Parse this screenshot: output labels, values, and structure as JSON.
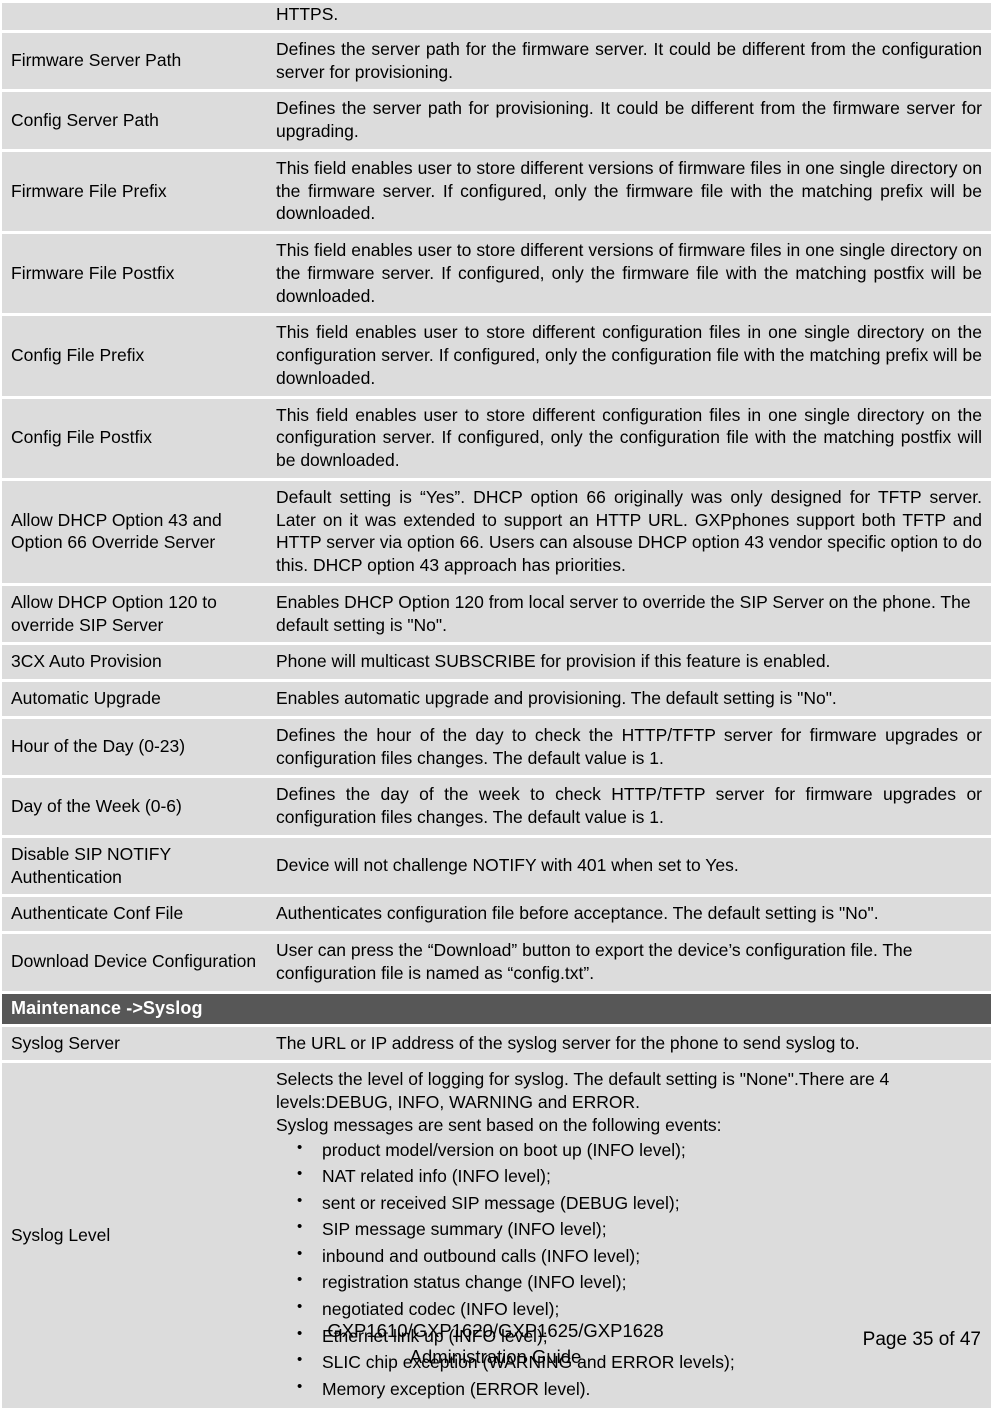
{
  "document": {
    "title": "GXP1610/GXP1620/GXP1625/GXP1628 Administration Guide",
    "footer": {
      "product_line": "GXP1610/GXP1620/GXP1625/GXP1628",
      "guide_line": "Administration Guide",
      "page_label": "Page 35 of 47"
    }
  },
  "table": {
    "clipped_top_row": {
      "name": "",
      "description": "HTTPS."
    },
    "rows": [
      {
        "name": "Firmware Server Path",
        "description": "Defines the server path for the firmware server. It could be different from the configuration server for provisioning."
      },
      {
        "name": "Config Server Path",
        "description": "Defines the server path for provisioning. It could be different from the firmware server for upgrading."
      },
      {
        "name": "Firmware File Prefix",
        "description": "This field enables user to store different versions of firmware files in one single directory on the firmware server. If configured, only the firmware file with the matching prefix will be downloaded."
      },
      {
        "name": "Firmware File Postfix",
        "description": "This field enables user to store different versions of firmware files in one single directory on the firmware server. If configured, only the firmware file with the matching postfix will be downloaded."
      },
      {
        "name": "Config File Prefix",
        "description": "This field enables user to store different configuration files in one single directory on the configuration server. If configured, only the configuration file with the matching prefix will be downloaded."
      },
      {
        "name": "Config File Postfix",
        "description": "This field enables user to store different configuration files in one single directory on the configuration server. If configured, only the configuration file with the matching postfix will be downloaded."
      },
      {
        "name": "Allow DHCP Option 43 and Option 66 Override Server",
        "description": "Default setting is “Yes”. DHCP option 66 originally was only designed for TFTP server. Later on it was extended to support an HTTP URL. GXPphones support both TFTP and HTTP server via option 66. Users can alsouse DHCP option 43 vendor specific option to do this. DHCP option 43 approach has priorities."
      },
      {
        "name": "Allow DHCP Option 120 to override SIP Server",
        "description": "Enables DHCP Option 120 from local server to override the SIP Server on the phone. The default setting is \"No\"."
      },
      {
        "name": "3CX Auto Provision",
        "description": "Phone will multicast SUBSCRIBE for provision if this feature is enabled."
      },
      {
        "name": "Automatic Upgrade",
        "description": "Enables automatic upgrade and provisioning. The default setting is \"No\"."
      },
      {
        "name": "Hour of the Day (0-23)",
        "description": "Defines the hour of the day to check the HTTP/TFTP server for firmware upgrades or configuration files changes. The default value is 1."
      },
      {
        "name": "Day of the Week (0-6)",
        "description": "Defines the day of the week to check HTTP/TFTP server for firmware upgrades or configuration files changes. The default value is 1."
      },
      {
        "name": "Disable SIP NOTIFY Authentication",
        "description": "Device will not challenge NOTIFY with 401 when set to Yes."
      },
      {
        "name": "Authenticate Conf File",
        "description": "Authenticates configuration file before acceptance. The default setting is \"No\"."
      },
      {
        "name": "Download Device Configuration",
        "description": "User can press the “Download” button to export the device’s configuration file. The configuration file is named as “config.txt”."
      }
    ],
    "section_header": "Maintenance ->Syslog",
    "rows_after_section": [
      {
        "name": "Syslog Server",
        "description": "The URL or IP address of the syslog server for the phone to send syslog to."
      }
    ],
    "syslog_level_row": {
      "name": "Syslog Level",
      "intro_line_1": "Selects the level of logging for syslog. The default setting is \"None\".There are 4 levels:DEBUG, INFO, WARNING and ERROR.",
      "intro_line_2": "Syslog messages are sent based on the following events:",
      "bullet_glyph": "•",
      "events": [
        "product model/version on boot up (INFO level);",
        "NAT related info (INFO level);",
        "sent or received SIP message (DEBUG level);",
        "SIP message summary (INFO level);",
        "inbound and outbound calls (INFO level);",
        "registration status change (INFO level);",
        "negotiated codec (INFO level);",
        "Ethernet link up (INFO level);",
        "SLIC chip exception (WARNING and ERROR levels);",
        "Memory exception (ERROR level)."
      ]
    }
  },
  "colors": {
    "cell_background": "#dcdcdc",
    "section_header_background": "#575757",
    "section_header_text": "#ffffff",
    "page_background": "#ffffff",
    "text": "#000000"
  }
}
